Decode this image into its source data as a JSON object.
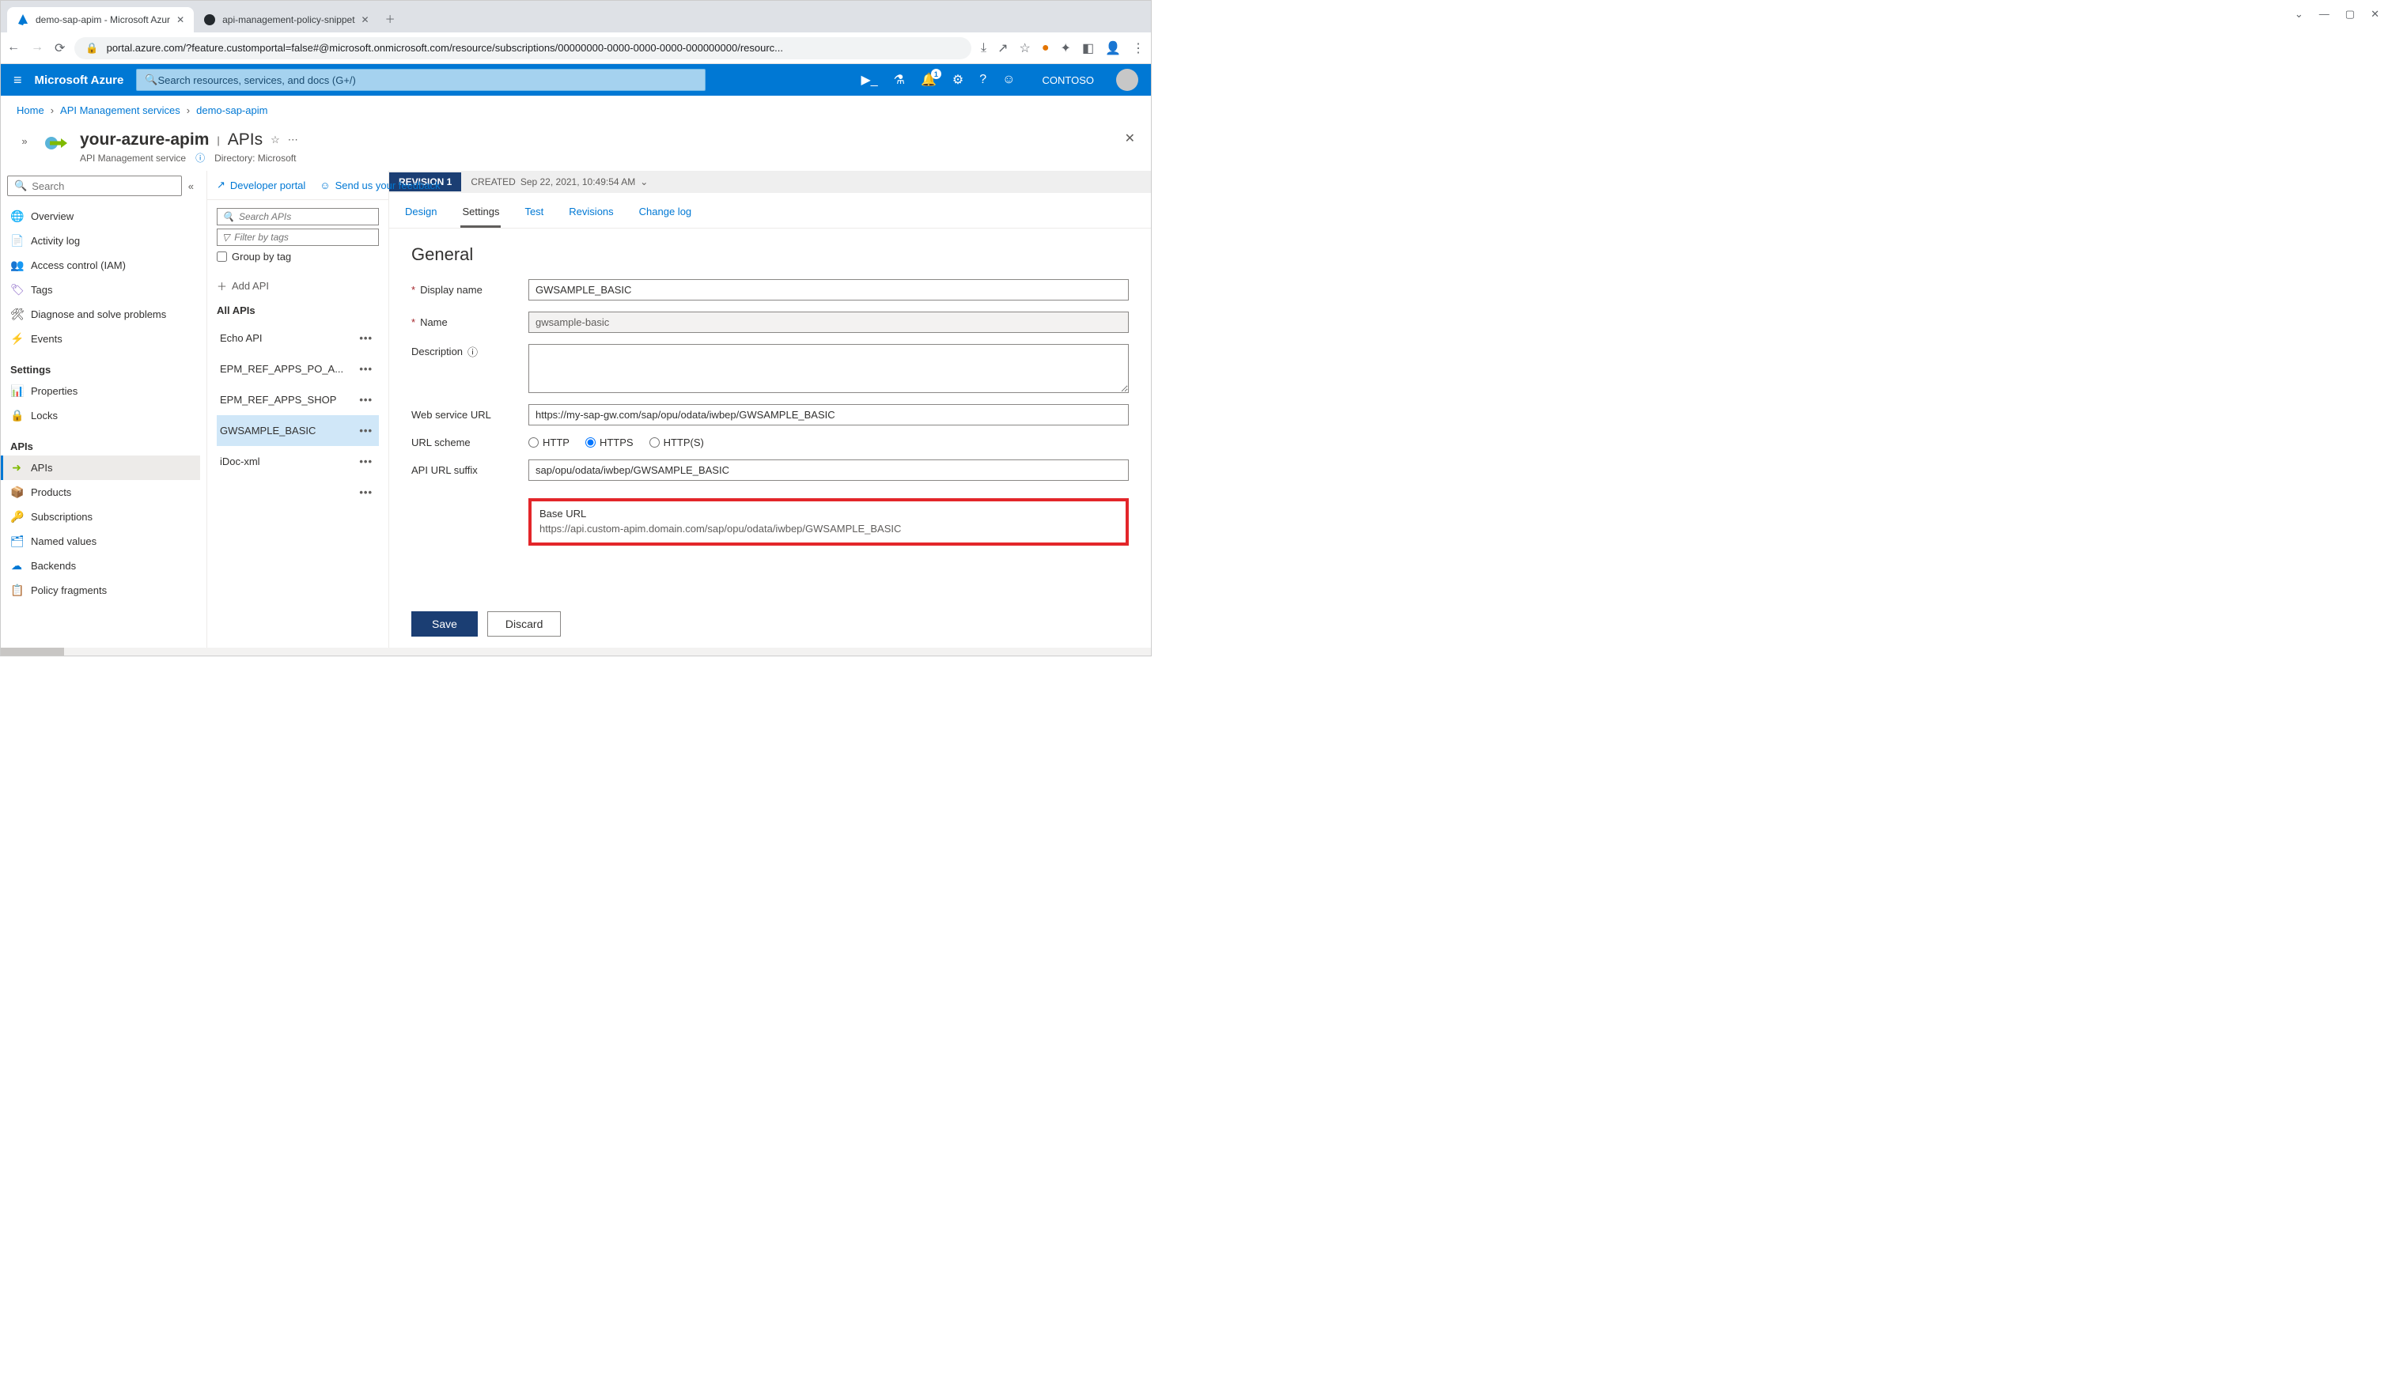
{
  "browser": {
    "tabs": [
      {
        "title": "demo-sap-apim - Microsoft Azur",
        "favicon": "azure"
      },
      {
        "title": "api-management-policy-snippet",
        "favicon": "github"
      }
    ],
    "url_display": "portal.azure.com/?feature.customportal=false#@microsoft.onmicrosoft.com/resource/subscriptions/00000000-0000-0000-0000-000000000/resourc..."
  },
  "header": {
    "brand": "Microsoft Azure",
    "search_placeholder": "Search resources, services, and docs (G+/)",
    "notification_count": "1",
    "tenant": "CONTOSO"
  },
  "breadcrumb": [
    "Home",
    "API Management services",
    "demo-sap-apim"
  ],
  "blade": {
    "resource_name": "your-azure-apim",
    "section": "APIs",
    "subtitle": "API Management service",
    "directory_label": "Directory: Microsoft"
  },
  "sidebar": {
    "search_placeholder": "Search",
    "groups": [
      {
        "heading": null,
        "items": [
          {
            "icon": "overview",
            "label": "Overview"
          },
          {
            "icon": "activity",
            "label": "Activity log"
          },
          {
            "icon": "iam",
            "label": "Access control (IAM)"
          },
          {
            "icon": "tags",
            "label": "Tags"
          },
          {
            "icon": "diagnose",
            "label": "Diagnose and solve problems"
          },
          {
            "icon": "events",
            "label": "Events"
          }
        ]
      },
      {
        "heading": "Settings",
        "items": [
          {
            "icon": "properties",
            "label": "Properties"
          },
          {
            "icon": "locks",
            "label": "Locks"
          }
        ]
      },
      {
        "heading": "APIs",
        "items": [
          {
            "icon": "apis",
            "label": "APIs",
            "selected": true
          },
          {
            "icon": "products",
            "label": "Products"
          },
          {
            "icon": "subs",
            "label": "Subscriptions"
          },
          {
            "icon": "named",
            "label": "Named values"
          },
          {
            "icon": "backends",
            "label": "Backends"
          },
          {
            "icon": "policy",
            "label": "Policy fragments"
          }
        ]
      }
    ]
  },
  "api_col": {
    "dev_portal": "Developer portal",
    "feedback": "Send us your feedback",
    "search_placeholder": "Search APIs",
    "filter_placeholder": "Filter by tags",
    "group_by_tag": "Group by tag",
    "add_api": "Add API",
    "all_apis": "All APIs",
    "items": [
      {
        "label": "Echo API"
      },
      {
        "label": "EPM_REF_APPS_PO_A..."
      },
      {
        "label": "EPM_REF_APPS_SHOP"
      },
      {
        "label": "GWSAMPLE_BASIC",
        "selected": true
      },
      {
        "label": "iDoc-xml"
      },
      {
        "label": ""
      }
    ]
  },
  "detail": {
    "revision_tag": "REVISION 1",
    "revision_meta_label": "CREATED",
    "revision_meta_value": "Sep 22, 2021, 10:49:54 AM",
    "tabs": [
      "Design",
      "Settings",
      "Test",
      "Revisions",
      "Change log"
    ],
    "active_tab": "Settings",
    "section_title": "General",
    "fields": {
      "display_name_label": "Display name",
      "display_name_value": "GWSAMPLE_BASIC",
      "name_label": "Name",
      "name_value": "gwsample-basic",
      "description_label": "Description",
      "description_value": "",
      "web_service_label": "Web service URL",
      "web_service_value": "https://my-sap-gw.com/sap/opu/odata/iwbep/GWSAMPLE_BASIC",
      "url_scheme_label": "URL scheme",
      "url_scheme_options": [
        "HTTP",
        "HTTPS",
        "HTTP(S)"
      ],
      "url_scheme_selected": "HTTPS",
      "api_suffix_label": "API URL suffix",
      "api_suffix_value": "sap/opu/odata/iwbep/GWSAMPLE_BASIC",
      "base_url_label": "Base URL",
      "base_url_value": "https://api.custom-apim.domain.com/sap/opu/odata/iwbep/GWSAMPLE_BASIC"
    },
    "save": "Save",
    "discard": "Discard"
  }
}
